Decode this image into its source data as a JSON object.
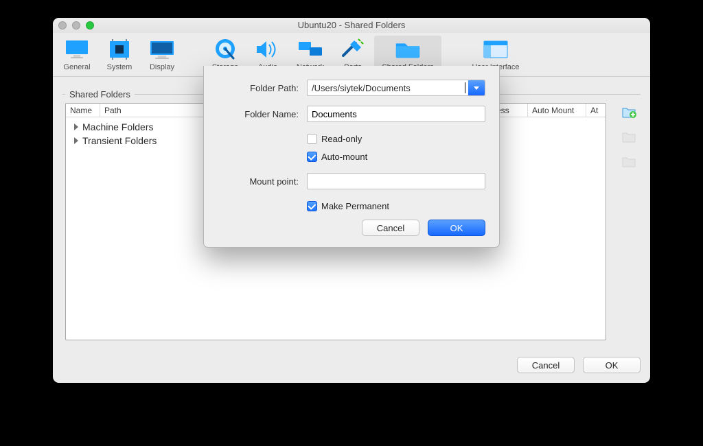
{
  "window": {
    "title": "Ubuntu20 - Shared Folders"
  },
  "toolbar": {
    "items": [
      {
        "id": "general",
        "label": "General"
      },
      {
        "id": "system",
        "label": "System"
      },
      {
        "id": "display",
        "label": "Display"
      },
      {
        "id": "storage",
        "label": "Storage"
      },
      {
        "id": "audio",
        "label": "Audio"
      },
      {
        "id": "network",
        "label": "Network"
      },
      {
        "id": "ports",
        "label": "Ports"
      },
      {
        "id": "shared",
        "label": "Shared Folders"
      },
      {
        "id": "ui",
        "label": "User Interface"
      }
    ]
  },
  "group": {
    "title": "Shared Folders"
  },
  "table": {
    "headers": {
      "name": "Name",
      "path": "Path",
      "access": "ess",
      "automount": "Auto Mount",
      "at": "At"
    },
    "rows": [
      {
        "label": "Machine Folders"
      },
      {
        "label": "Transient Folders"
      }
    ]
  },
  "sheet": {
    "folderPathLabel": "Folder Path:",
    "folderPathValue": "/Users/siytek/Documents",
    "folderNameLabel": "Folder Name:",
    "folderNameValue": "Documents",
    "readOnlyLabel": "Read-only",
    "readOnlyChecked": false,
    "autoMountLabel": "Auto-mount",
    "autoMountChecked": true,
    "mountPointLabel": "Mount point:",
    "mountPointValue": "",
    "makePermanentLabel": "Make Permanent",
    "makePermanentChecked": true,
    "cancel": "Cancel",
    "ok": "OK"
  },
  "footer": {
    "cancel": "Cancel",
    "ok": "OK"
  }
}
